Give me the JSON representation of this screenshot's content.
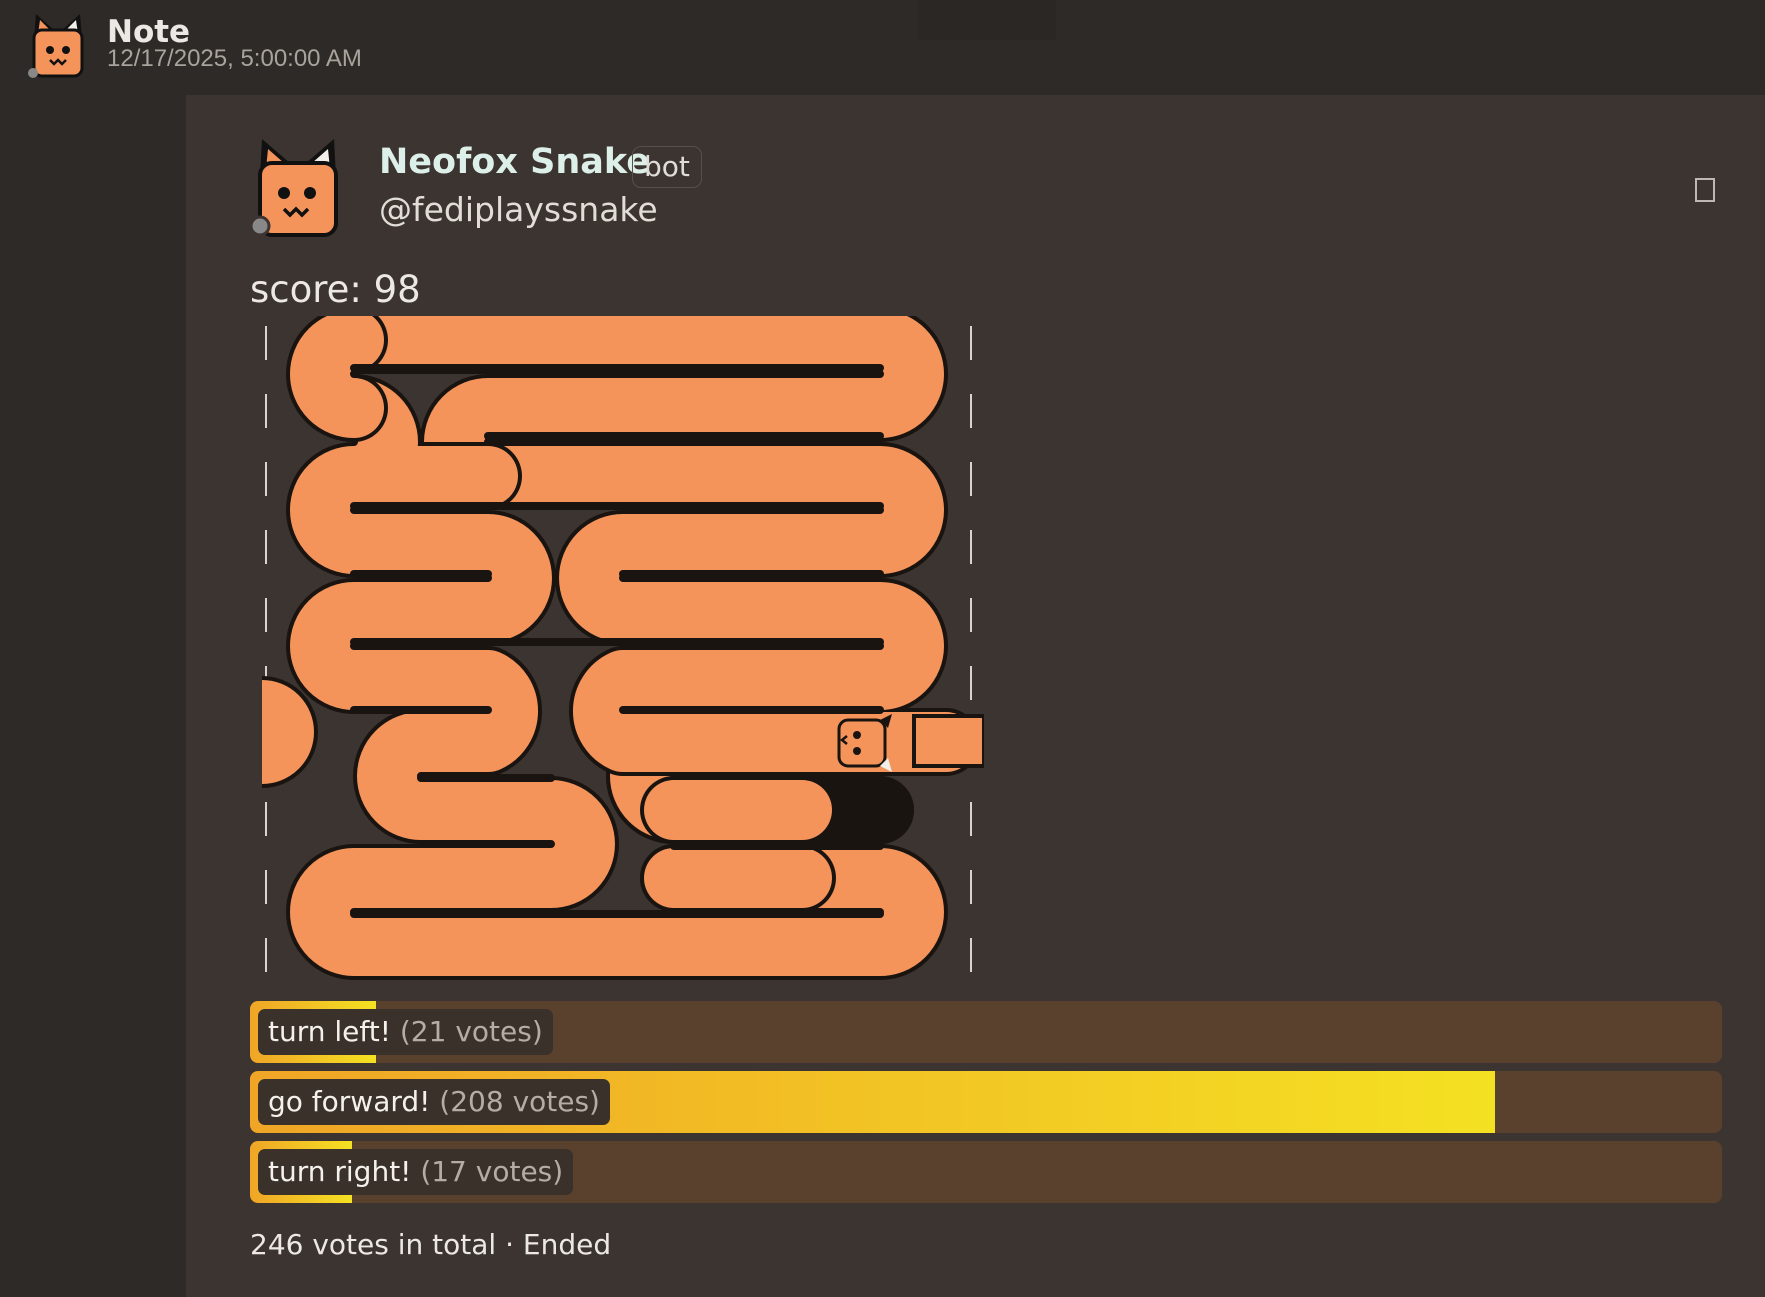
{
  "header": {
    "title": "Note",
    "date": "12/17/2025, 5:00:00 AM"
  },
  "post": {
    "author_name": "Neofox Snake",
    "bot_badge": "bot",
    "handle": "@fediplayssnake",
    "score_text": "score: 98"
  },
  "poll": {
    "options": [
      {
        "label": "turn left!",
        "votes_text": "(21 votes)",
        "votes": 21
      },
      {
        "label": "go forward!",
        "votes_text": "(208 votes)",
        "votes": 208
      },
      {
        "label": "turn right!",
        "votes_text": "(17 votes)",
        "votes": 17
      }
    ],
    "footer": "246 votes in total · Ended"
  },
  "colors": {
    "snake_body": "#f4945b",
    "snake_outline": "#1a1411",
    "fill_start": "#f0a526",
    "fill_end": "#f4e122",
    "poll_track": "#5a412d",
    "card_bg": "#3c3430"
  },
  "icons": {
    "avatar": "neofox-avatar-icon",
    "menu": "menu-toggle-icon"
  }
}
